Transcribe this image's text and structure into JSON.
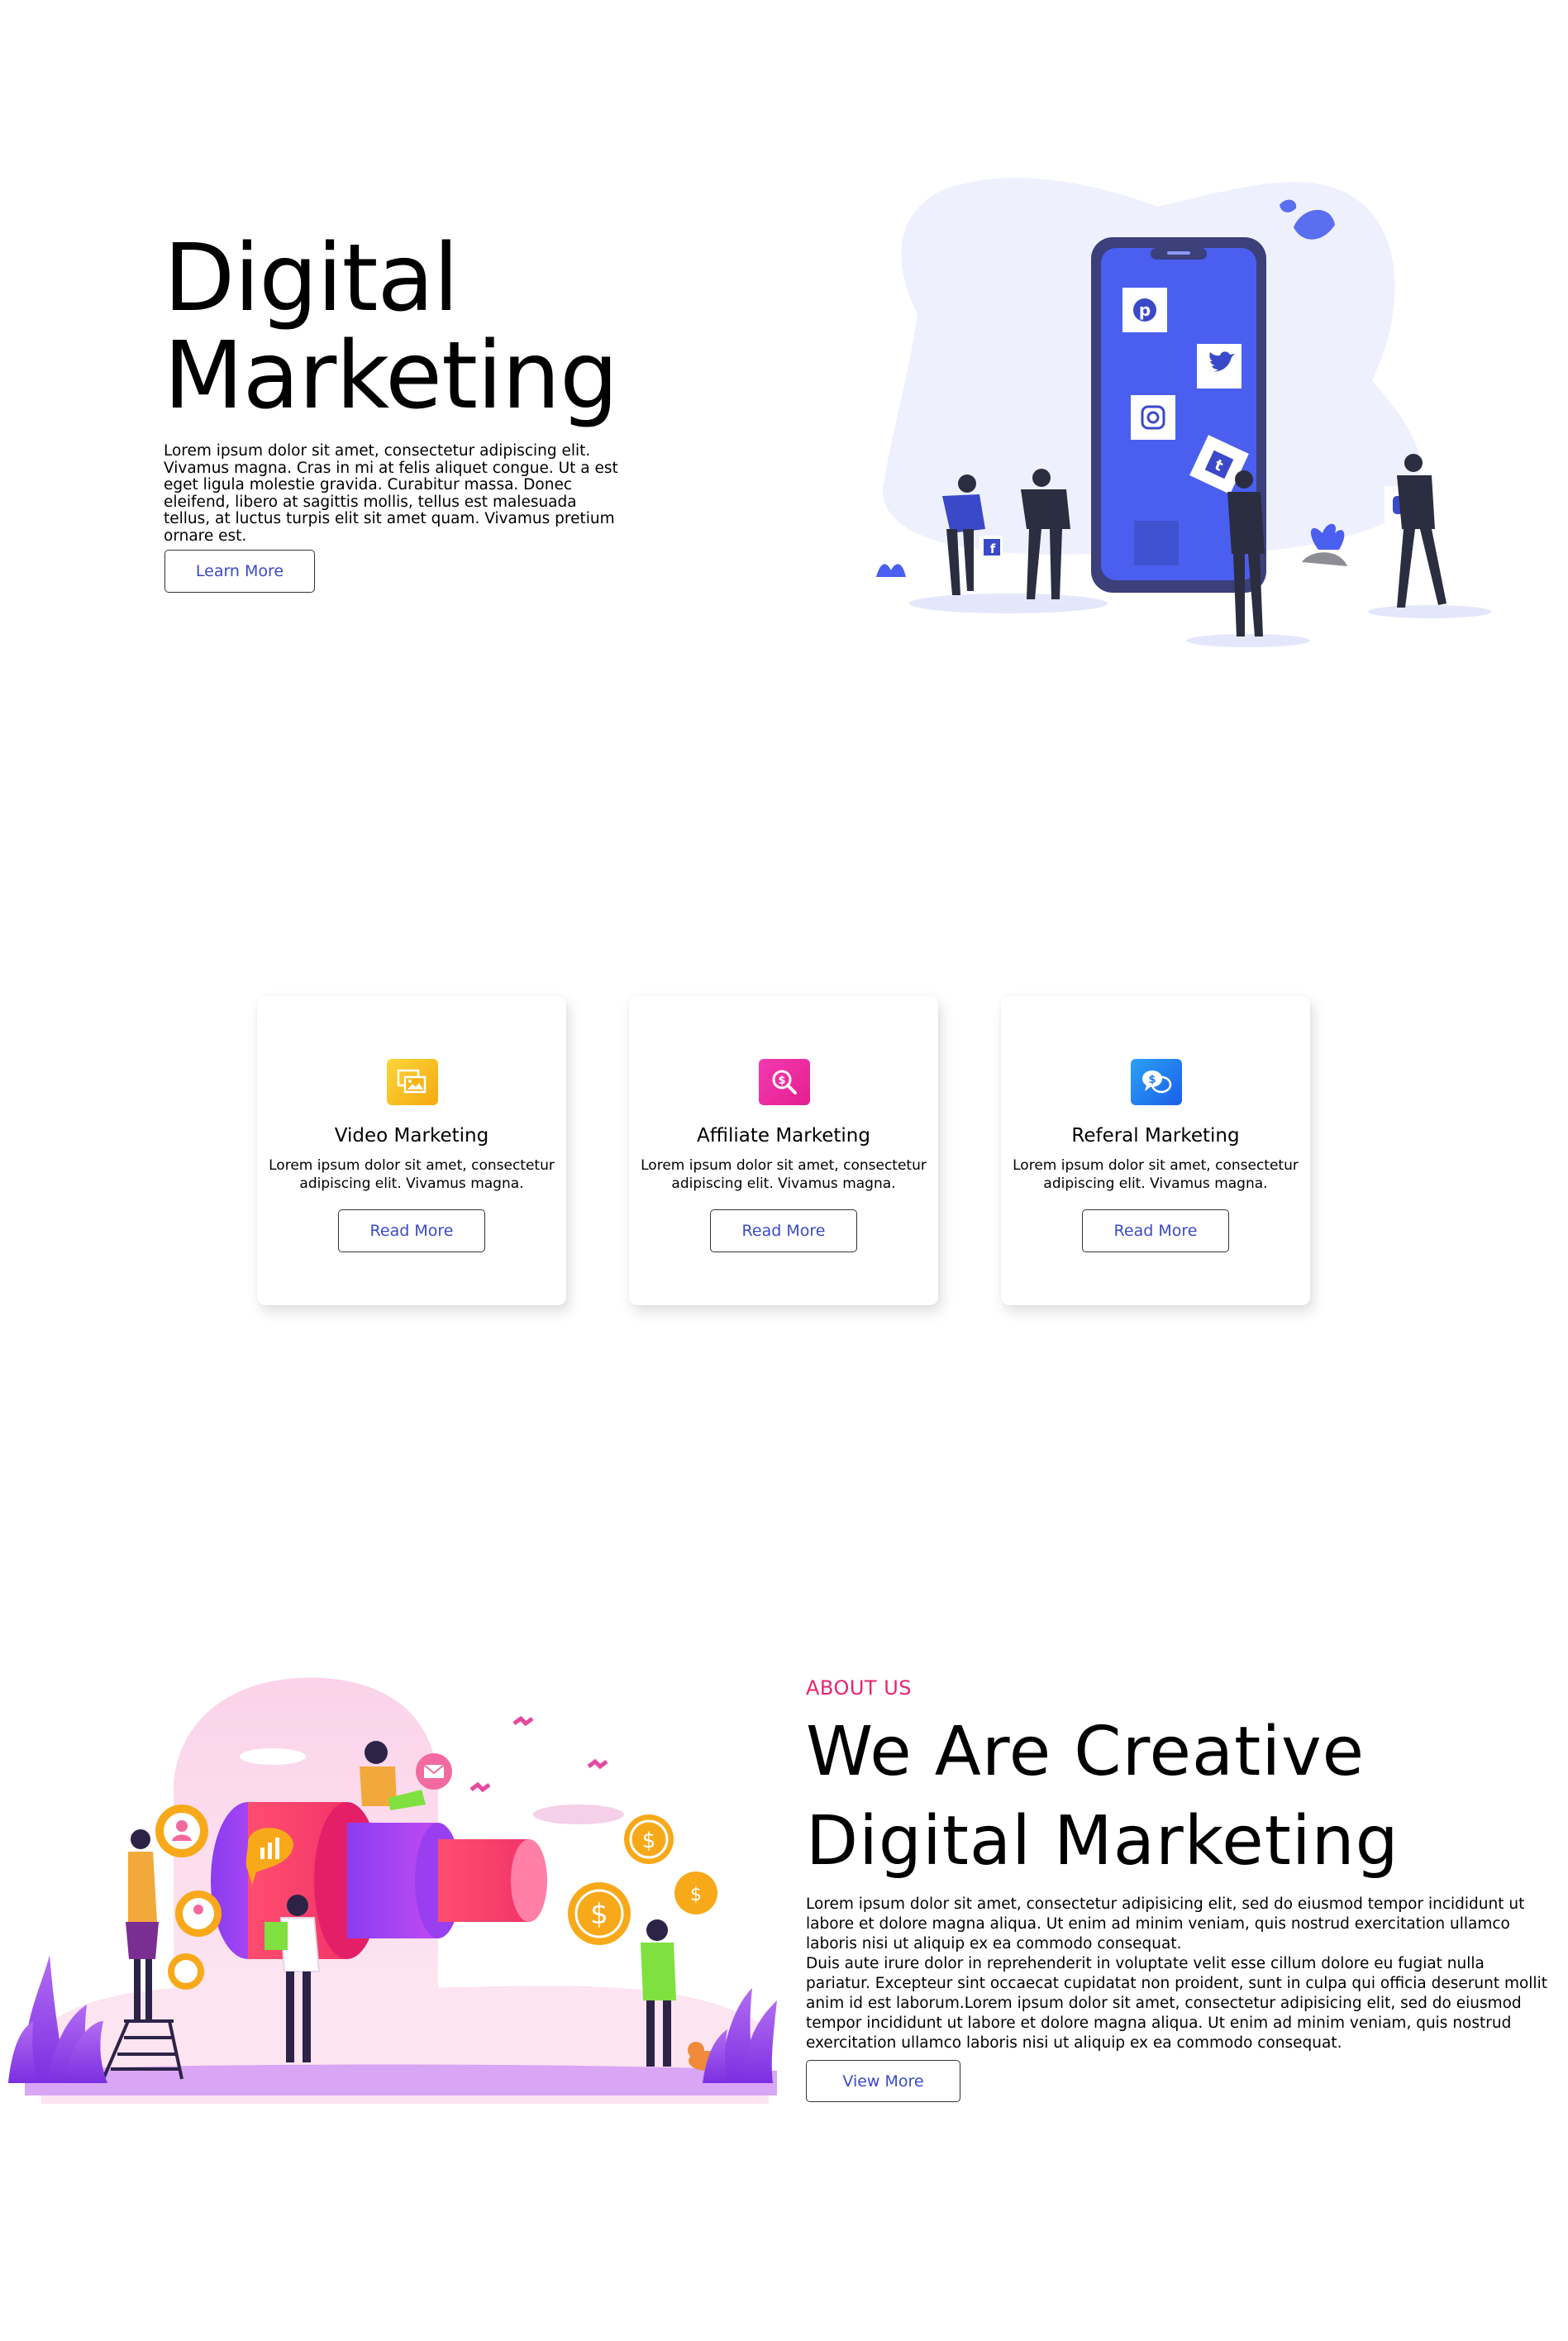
{
  "hero": {
    "title_line1": "Digital",
    "title_line2": "Marketing",
    "description": "Lorem ipsum dolor sit amet, consectetur adipiscing elit. Vivamus magna. Cras in mi at felis aliquet congue. Ut a est eget ligula molestie gravida. Curabitur massa. Donec eleifend, libero at sagittis mollis, tellus est malesuada tellus, at luctus turpis elit sit amet quam. Vivamus pretium ornare est.",
    "button_label": "Learn More"
  },
  "services": [
    {
      "icon": "video-image-icon",
      "icon_color": "#f9c413",
      "title": "Video Marketing",
      "description": "Lorem ipsum dolor sit amet, consectetur adipiscing elit. Vivamus magna.",
      "button_label": "Read More"
    },
    {
      "icon": "search-dollar-icon",
      "icon_color": "#ee2ba0",
      "title": "Affiliate Marketing",
      "description": "Lorem ipsum dolor sit amet, consectetur adipiscing elit. Vivamus magna.",
      "button_label": "Read More"
    },
    {
      "icon": "chat-bubbles-icon",
      "icon_color": "#1f7bf0",
      "title": "Referal Marketing",
      "description": "Lorem ipsum dolor sit amet, consectetur adipiscing elit. Vivamus magna.",
      "button_label": "Read More"
    }
  ],
  "about": {
    "kicker": "ABOUT US",
    "title_line1": "We Are Creative",
    "title_line2": "Digital Marketing",
    "paragraph1": "Lorem ipsum dolor sit amet, consectetur adipisicing elit, sed do eiusmod tempor incididunt ut labore et dolore magna aliqua. Ut enim ad minim veniam, quis nostrud exercitation ullamco laboris nisi ut aliquip ex ea commodo consequat.",
    "paragraph2": "Duis aute irure dolor in reprehenderit in voluptate velit esse cillum dolore eu fugiat nulla pariatur. Excepteur sint occaecat cupidatat non proident, sunt in culpa qui officia deserunt mollit anim id est laborum.Lorem ipsum dolor sit amet, consectetur adipisicing elit, sed do eiusmod tempor incididunt ut labore et dolore magna aliqua. Ut enim ad minim veniam, quis nostrud exercitation ullamco laboris nisi ut aliquip ex ea commodo consequat.",
    "button_label": "View More",
    "accent_color": "#e8246d"
  },
  "colors": {
    "button_text": "#3a49c8",
    "phone_blue": "#4a5ff0",
    "blob_light": "#eef0fd"
  }
}
